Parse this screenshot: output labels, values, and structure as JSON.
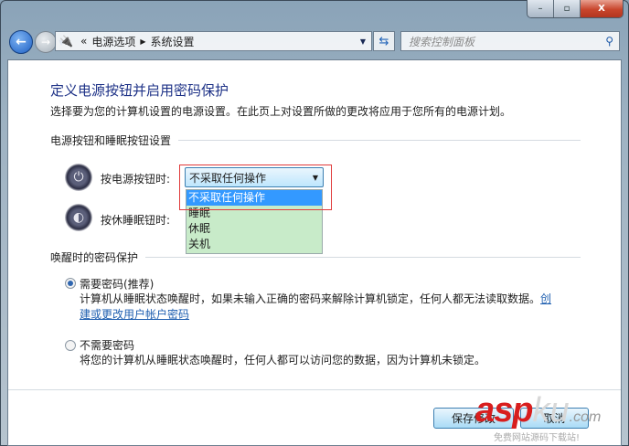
{
  "window": {
    "minimize": "–",
    "maximize": "▫",
    "close": "X"
  },
  "nav": {
    "breadcrumb": [
      "电源选项",
      "系统设置"
    ],
    "overflow": "«",
    "search_placeholder": "搜索控制面板"
  },
  "main": {
    "title": "定义电源按钮并启用密码保护",
    "subtitle": "选择要为您的计算机设置的电源设置。在此页上对设置所做的更改将应用于您所有的电源计划。",
    "section1": "电源按钮和睡眠按钮设置",
    "power_label": "按电源按钮时:",
    "sleep_label": "按休睡眠钮时:",
    "combo_value": "不采取任何操作",
    "options": [
      "不采取任何操作",
      "睡眠",
      "休眠",
      "关机"
    ],
    "section2": "唤醒时的密码保护",
    "radio1": "需要密码(推荐)",
    "radio1_desc": "计算机从睡眠状态唤醒时，如果未输入正确的密码来解除计算机锁定，任何人都无法读取数据。",
    "radio1_link1": "创",
    "radio1_link2": "建或更改用户帐户密码",
    "radio2": "不需要密码",
    "radio2_desc": "将您的计算机从睡眠状态唤醒时，任何人都可以访问您的数据，因为计算机未锁定。",
    "save": "保存修改",
    "cancel": "取消"
  },
  "watermark": {
    "brand_a": "asp",
    "brand_b": "ku",
    ".com": ".com",
    "slogan": "免费网站源码下载站!"
  }
}
